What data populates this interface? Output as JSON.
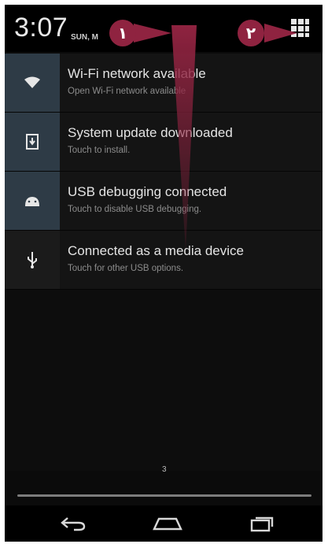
{
  "status": {
    "time": "3:07",
    "date": "SUN, M"
  },
  "notifications": [
    {
      "icon": "wifi-icon",
      "title": "Wi-Fi network available",
      "subtitle": "Open Wi-Fi network available"
    },
    {
      "icon": "download-icon",
      "title": "System update downloaded",
      "subtitle": "Touch to install."
    },
    {
      "icon": "android-icon",
      "title": "USB debugging connected",
      "subtitle": "Touch to disable USB debugging."
    },
    {
      "icon": "usb-icon",
      "title": "Connected as a media device",
      "subtitle": "Touch for other USB options."
    }
  ],
  "home_page_indicator": "3",
  "annotations": {
    "badge_1": "١",
    "badge_2": "٢"
  },
  "colors": {
    "badge": "#8f2340",
    "icon_tile": "#2e3b46"
  },
  "navigation": [
    "back-icon",
    "home-icon",
    "recents-icon"
  ]
}
